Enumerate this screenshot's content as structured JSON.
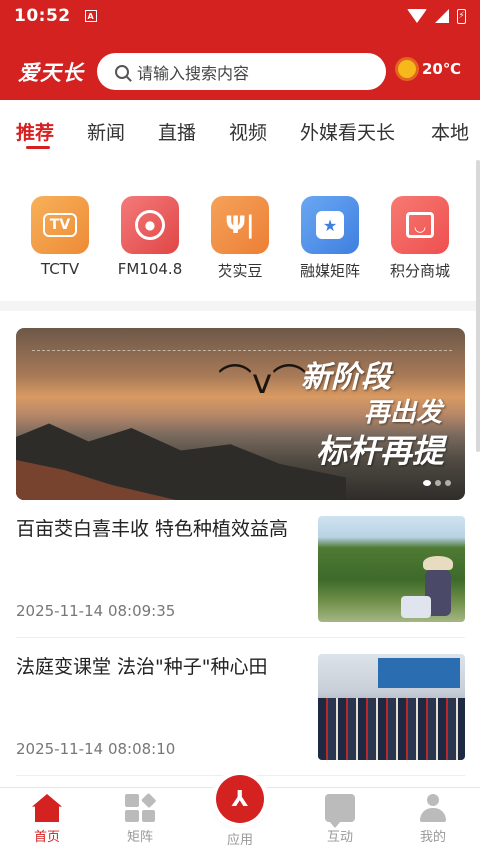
{
  "status_bar": {
    "time": "10:52",
    "indicator": "A"
  },
  "header": {
    "logo": "爱天长",
    "search_placeholder": "请输入搜索内容",
    "weather_icon": "sun-icon",
    "temperature": "20℃"
  },
  "tabs": [
    {
      "label": "推荐",
      "active": true
    },
    {
      "label": "新闻"
    },
    {
      "label": "直播"
    },
    {
      "label": "视频"
    },
    {
      "label": "外媒看天长"
    },
    {
      "label": "本地"
    }
  ],
  "shortcuts": [
    {
      "label": "TCTV",
      "icon": "tv-icon",
      "color": "#f39a3e",
      "glyph": "TV"
    },
    {
      "label": "FM104.8",
      "icon": "radio-icon",
      "color": "#ea4f4f",
      "glyph": "◉"
    },
    {
      "label": "芡实豆",
      "icon": "utensils-icon",
      "color": "#f08a3c",
      "glyph": "ΨΙ"
    },
    {
      "label": "融媒矩阵",
      "icon": "star-badge-icon",
      "color": "#4a8fe8",
      "glyph": "★"
    },
    {
      "label": "积分商城",
      "icon": "shopping-bag-icon",
      "color": "#f25d5d",
      "glyph": "◡"
    }
  ],
  "banner": {
    "line1": "新阶段",
    "line2": "再出发",
    "line3": "标杆再提"
  },
  "news": [
    {
      "title": "百亩茭白喜丰收 特色种植效益高",
      "time": "2025-11-14 08:09:35"
    },
    {
      "title": "法庭变课堂 法治\"种子\"种心田",
      "time": "2025-11-14 08:08:10"
    }
  ],
  "bottom_nav": {
    "home": "首页",
    "matrix": "矩阵",
    "apps": "应用",
    "interact": "互动",
    "mine": "我的"
  },
  "colors": {
    "brand": "#d42220"
  }
}
